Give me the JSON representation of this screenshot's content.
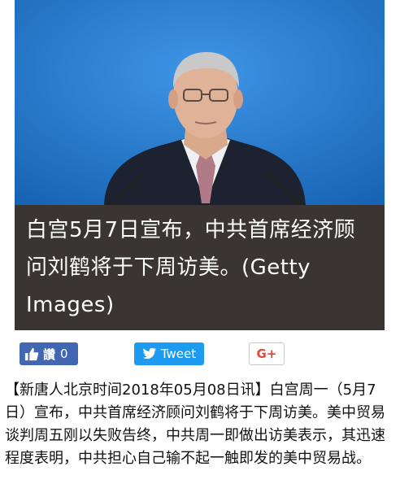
{
  "photo": {
    "alt": "",
    "background_color": "#1e73c8"
  },
  "caption": {
    "text": "白宫5月7日宣布，中共首席经济顾问刘鹤将于下周访美。(Getty Images)"
  },
  "share": {
    "like_label": "讚",
    "like_count": "0",
    "tweet_label": "Tweet",
    "gplus_label": "G+",
    "colors": {
      "facebook": "#4267b2",
      "twitter": "#1d9bf0",
      "gplus": "#dd4b39"
    }
  },
  "article": {
    "text": "【新唐人北京时间2018年05月08日讯】白宫周一（5月7日）宣布，中共首席经济顾问刘鹤将于下周访美。美中贸易谈判周五刚以失败告终，中共周一即做出访美表示，其迅速程度表明，中共担心自己输不起一触即发的美中贸易战。"
  }
}
